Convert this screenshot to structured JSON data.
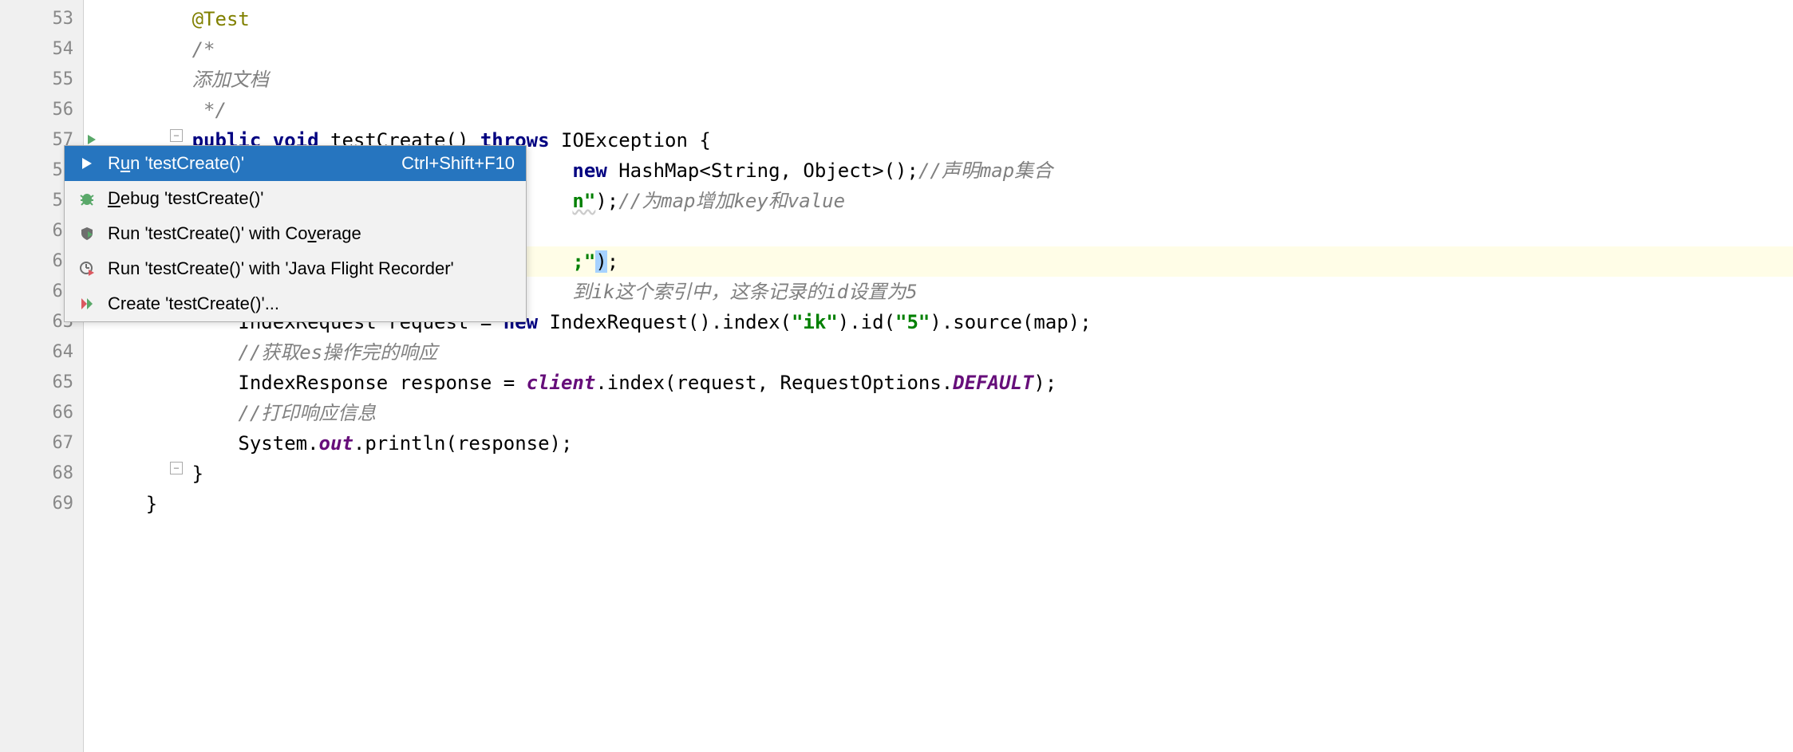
{
  "lines": {
    "start": 53,
    "end": 69
  },
  "code": {
    "l53": {
      "annotation": "@Test"
    },
    "l54": {
      "comment": "/*"
    },
    "l55": {
      "comment": "添加文档"
    },
    "l56": {
      "comment": " */"
    },
    "l57": {
      "kw1": "public",
      "kw2": "void",
      "method": "testCreate",
      "kw3": "throws",
      "exc": "IOException",
      "brace": " {"
    },
    "l58": {
      "kw": "new",
      "cls": "HashMap",
      "gen": "<String, Object>",
      "tail": "();",
      "comment": "//声明map集合"
    },
    "l59": {
      "partial": "n\"",
      "tail": ");",
      "comment": "//为map增加key和value"
    },
    "l61": {
      "partial": ";\"",
      "tail": ");"
    },
    "l62": {
      "comment": "到ik这个索引中，这条记录的id设置为5"
    },
    "l63": {
      "cls1": "IndexRequest",
      "var": " request = ",
      "kw": "new",
      "cls2": " IndexRequest().index(",
      "s1": "\"ik\"",
      "mid": ").id(",
      "s2": "\"5\"",
      "tail": ").source(map);"
    },
    "l64": {
      "comment": "//获取es操作完的响应"
    },
    "l65": {
      "cls": "IndexResponse",
      "var": " response = ",
      "field": "client",
      "mid": ".index(request, RequestOptions.",
      "sf": "DEFAULT",
      "tail": ");"
    },
    "l66": {
      "comment": "//打印响应信息"
    },
    "l67": {
      "cls": "System.",
      "field": "out",
      "tail": ".println(response);"
    },
    "l68": {
      "brace": "}"
    },
    "l69": {
      "brace": "}"
    }
  },
  "menu": {
    "items": [
      {
        "label_pre": "R",
        "mnemonic": "u",
        "label_post": "n 'testCreate()'",
        "shortcut": "Ctrl+Shift+F10",
        "icon": "run-icon",
        "selected": true
      },
      {
        "label_pre": "",
        "mnemonic": "D",
        "label_post": "ebug 'testCreate()'",
        "shortcut": "",
        "icon": "debug-icon",
        "selected": false
      },
      {
        "label_pre": "Run 'testCreate()' with Co",
        "mnemonic": "v",
        "label_post": "erage",
        "shortcut": "",
        "icon": "coverage-icon",
        "selected": false
      },
      {
        "label_pre": "Run 'testCreate()' with 'Java Flight Recorder'",
        "mnemonic": "",
        "label_post": "",
        "shortcut": "",
        "icon": "profiler-icon",
        "selected": false
      },
      {
        "label_pre": "Create 'testCreate()'...",
        "mnemonic": "",
        "label_post": "",
        "shortcut": "",
        "icon": "create-config-icon",
        "selected": false
      }
    ]
  }
}
